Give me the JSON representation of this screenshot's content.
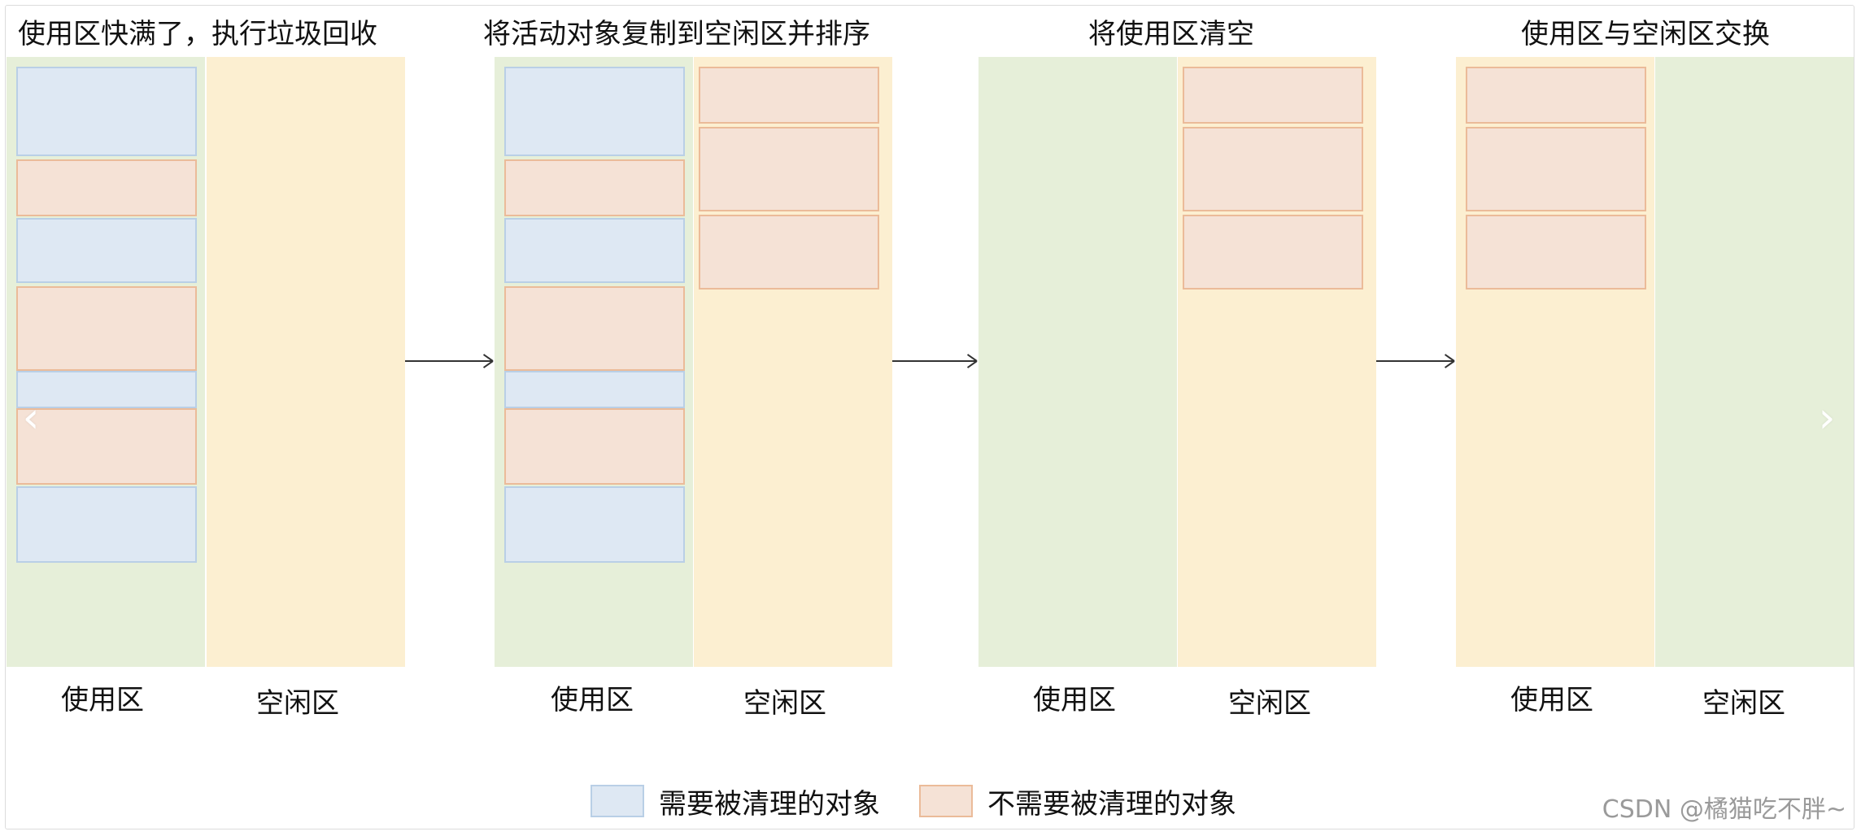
{
  "steps": [
    {
      "title": "使用区快满了，执行垃圾回收",
      "left_label": "使用区",
      "right_label": "空闲区",
      "left_role": "used",
      "right_role": "free",
      "left_objects": [
        "garbage",
        "live",
        "garbage",
        "live",
        "garbage",
        "live",
        "garbage"
      ],
      "right_objects": []
    },
    {
      "title": "将活动对象复制到空闲区并排序",
      "left_label": "使用区",
      "right_label": "空闲区",
      "left_role": "used",
      "right_role": "free",
      "left_objects": [
        "garbage",
        "live",
        "garbage",
        "live",
        "garbage",
        "live",
        "garbage"
      ],
      "right_objects": [
        "live",
        "live",
        "live"
      ]
    },
    {
      "title": "将使用区清空",
      "left_label": "使用区",
      "right_label": "空闲区",
      "left_role": "used",
      "right_role": "free",
      "left_objects": [],
      "right_objects": [
        "live",
        "live",
        "live"
      ]
    },
    {
      "title": "使用区与空闲区交换",
      "left_label": "使用区",
      "right_label": "空闲区",
      "left_role": "free",
      "right_role": "used",
      "left_objects": [
        "live",
        "live",
        "live"
      ],
      "right_objects": []
    }
  ],
  "legend": [
    {
      "label": "需要被清理的对象",
      "kind": "garbage"
    },
    {
      "label": "不需要被清理的对象",
      "kind": "live"
    }
  ],
  "watermark": "CSDN @橘猫吃不胖~",
  "colors": {
    "used_region": "#e6efd9",
    "free_region": "#fcefd1",
    "garbage_fill": "#dee8f3",
    "garbage_border": "#b9cfe6",
    "live_fill": "#f5e2d6",
    "live_border": "#ebbb99",
    "arrow": "#333333"
  },
  "icons": {
    "prev": "chevron-left-icon",
    "next": "chevron-right-icon",
    "arrow": "right-arrow-icon"
  }
}
